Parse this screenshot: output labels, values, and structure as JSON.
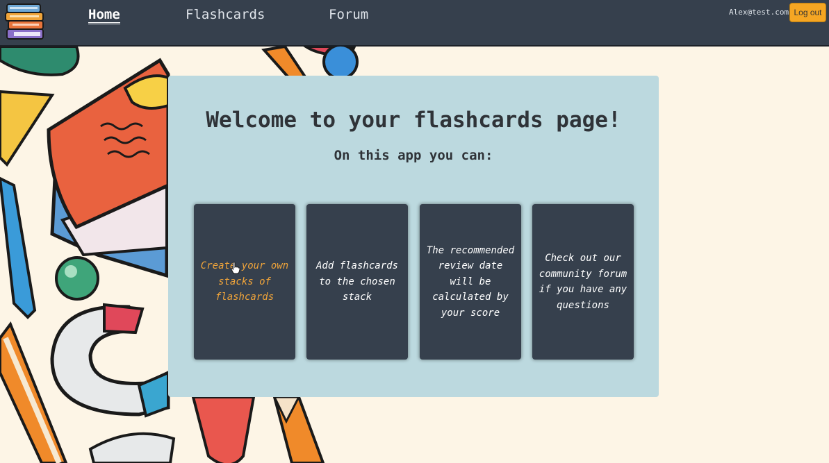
{
  "nav": {
    "links": [
      {
        "label": "Home",
        "active": true
      },
      {
        "label": "Flashcards",
        "active": false
      },
      {
        "label": "Forum",
        "active": false
      }
    ],
    "user_email": "Alex@test.com",
    "logout_label": "Log out"
  },
  "main": {
    "title": "Welcome to your flashcards page!",
    "subtitle": "On this app you can:",
    "cards": [
      {
        "text": "Create your own stacks of flashcards",
        "highlighted": true
      },
      {
        "text": "Add flashcards to the chosen stack",
        "highlighted": false
      },
      {
        "text": "The recommended review date will be calculated by your score",
        "highlighted": false
      },
      {
        "text": "Check out our community forum if you have any questions",
        "highlighted": false
      }
    ]
  },
  "colors": {
    "navbar": "#36404d",
    "accent": "#f5a623",
    "panel": "#bcd9df",
    "card": "#36404d",
    "background": "#fdf5e6"
  },
  "icons": [
    "books-logo-icon",
    "hand-cursor-icon"
  ]
}
